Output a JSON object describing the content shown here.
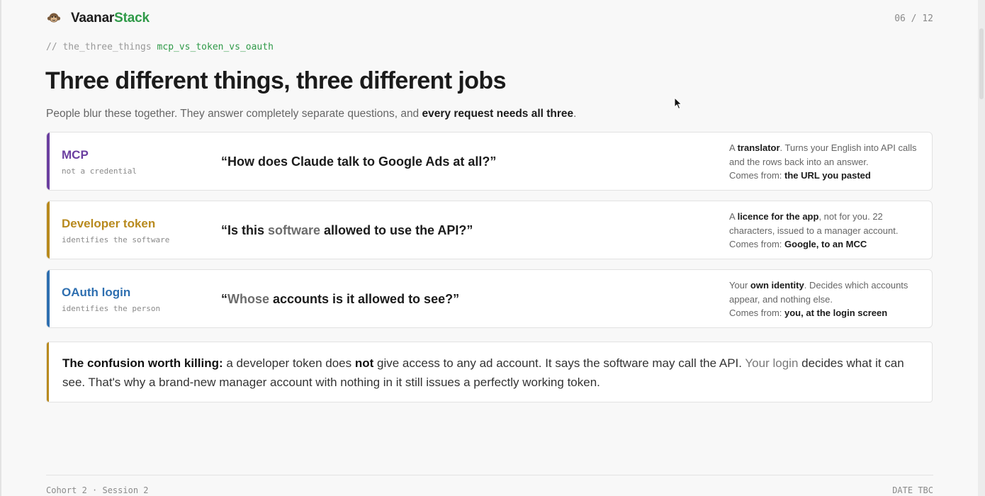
{
  "header": {
    "brand_part1": "Vaanar",
    "brand_part2": "Stack",
    "logo_icon": "monkey-icon",
    "page_counter": "06 / 12"
  },
  "breadcrumb": {
    "prefix": "// the_three_things",
    "highlight": "mcp_vs_token_vs_oauth"
  },
  "title": "Three different things, three different jobs",
  "subtitle": {
    "text": "People blur these together. They answer completely separate questions, and",
    "bold": "every request needs all three",
    "end": "."
  },
  "cards": [
    {
      "name": "MCP",
      "tag": "not a credential",
      "accent": "#6b3fa0",
      "question": {
        "a": "“How does Claude talk to Google Ads at all?”",
        "muted": "",
        "b": ""
      },
      "desc": {
        "p1": "A ",
        "b1": "translator",
        "p2": ". Turns your English into API calls and the rows back into an answer.",
        "p3": "Comes from: ",
        "b2": "the URL you pasted"
      }
    },
    {
      "name": "Developer token",
      "tag": "identifies the software",
      "accent": "#b88a1e",
      "question": {
        "a": "“Is this ",
        "muted": "software",
        "b": " allowed to use the API?”"
      },
      "desc": {
        "p1": "A ",
        "b1": "licence for the app",
        "p2": ", not for you. 22 characters, issued to a manager account.",
        "p3": "Comes from: ",
        "b2": "Google, to an MCC"
      }
    },
    {
      "name": "OAuth login",
      "tag": "identifies the person",
      "accent": "#2e6fb0",
      "question": {
        "a": "“",
        "muted": "Whose",
        "b": " accounts is it allowed to see?”"
      },
      "desc": {
        "p1": "Your ",
        "b1": "own identity",
        "p2": ". Decides which accounts appear, and nothing else.",
        "p3": "Comes from: ",
        "b2": "you, at the login screen"
      }
    }
  ],
  "callout": {
    "bold_lead": "The confusion worth killing:",
    "t1": " a developer token does ",
    "bold_not": "not",
    "t2": " give access to any ad account. It says the software may call the API. ",
    "muted": "Your login",
    "t3": " decides what it can see. That's why a brand-new manager account with nothing in it still issues a perfectly working token."
  },
  "footer": {
    "left": "Cohort 2 · Session 2",
    "right": "DATE TBC"
  }
}
